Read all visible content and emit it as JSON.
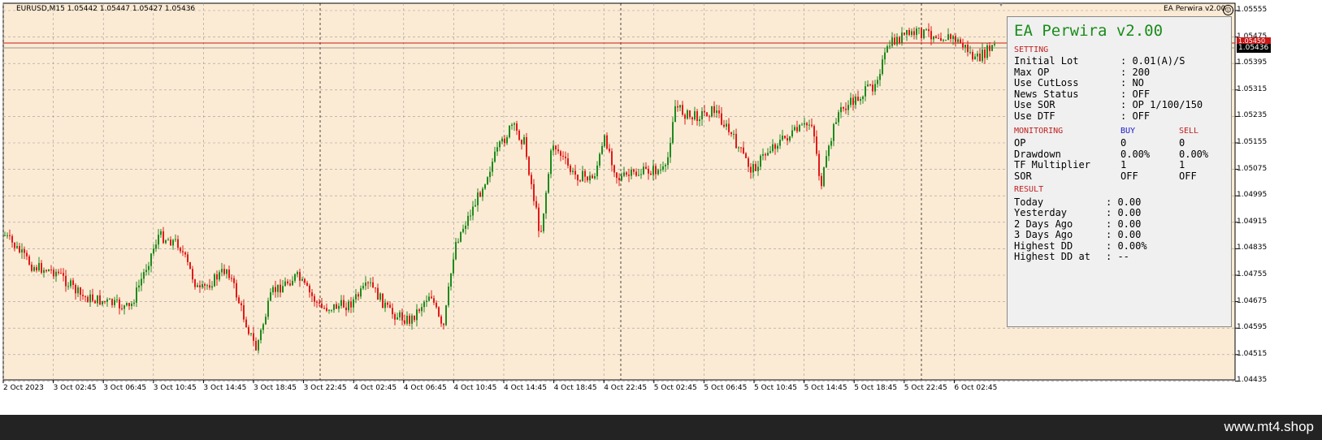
{
  "symbol_header": "EURUSD,M15  1.05442 1.05447 1.05427 1.05436",
  "ea_tag": "EA Perwira v2.00",
  "smile_glyph": "☺",
  "colors": {
    "background": "#fcebd4",
    "bull": "#1e8a1e",
    "bear": "#e01a1a",
    "grid": "#9a9a9a",
    "price_line": "#c81818",
    "panel": "#f0f0f0",
    "footer": "#232323"
  },
  "price_axis": {
    "labels": [
      "1.05555",
      "1.05475",
      "1.05395",
      "1.05315",
      "1.05235",
      "1.05155",
      "1.05075",
      "1.04995",
      "1.04915",
      "1.04835",
      "1.04755",
      "1.04675",
      "1.04595",
      "1.04515",
      "1.04435"
    ],
    "current_bid": "1.05436",
    "current_ask": "1.05450"
  },
  "time_axis": [
    "2 Oct 2023",
    "3 Oct 02:45",
    "3 Oct 06:45",
    "3 Oct 10:45",
    "3 Oct 14:45",
    "3 Oct 18:45",
    "3 Oct 22:45",
    "4 Oct 02:45",
    "4 Oct 06:45",
    "4 Oct 10:45",
    "4 Oct 14:45",
    "4 Oct 18:45",
    "4 Oct 22:45",
    "5 Oct 02:45",
    "5 Oct 06:45",
    "5 Oct 10:45",
    "5 Oct 14:45",
    "5 Oct 18:45",
    "5 Oct 22:45",
    "6 Oct 02:45"
  ],
  "panel": {
    "title": "EA Perwira v2.00",
    "setting_header": "SETTING",
    "settings": [
      {
        "key": "Initial Lot",
        "value": ": 0.01(A)/S"
      },
      {
        "key": "Max OP",
        "value": ": 200"
      },
      {
        "key": "Use CutLoss",
        "value": ": NO"
      },
      {
        "key": "News Status",
        "value": ": OFF"
      },
      {
        "key": "Use SOR",
        "value": ": OP 1/100/150"
      },
      {
        "key": "Use DTF",
        "value": ": OFF"
      }
    ],
    "monitoring_header": "MONITORING",
    "buy_header": "BUY",
    "sell_header": "SELL",
    "monitoring": [
      {
        "key": "OP",
        "buy": "0",
        "sell": "0"
      },
      {
        "key": "Drawdown",
        "buy": "0.00%",
        "sell": "0.00%"
      },
      {
        "key": "TF Multiplier",
        "buy": "1",
        "sell": "1"
      },
      {
        "key": "SOR",
        "buy": "OFF",
        "sell": "OFF"
      }
    ],
    "result_header": "RESULT",
    "results": [
      {
        "key": "Today",
        "value": ": 0.00"
      },
      {
        "key": "Yesterday",
        "value": ": 0.00"
      },
      {
        "key": "2 Days Ago",
        "value": ": 0.00"
      },
      {
        "key": "3 Days Ago",
        "value": ": 0.00"
      },
      {
        "key": "Highest DD",
        "value": ": 0.00%"
      },
      {
        "key": "Highest DD at",
        "value": ": --"
      }
    ]
  },
  "footer_brand": "www.mt4.shop"
}
